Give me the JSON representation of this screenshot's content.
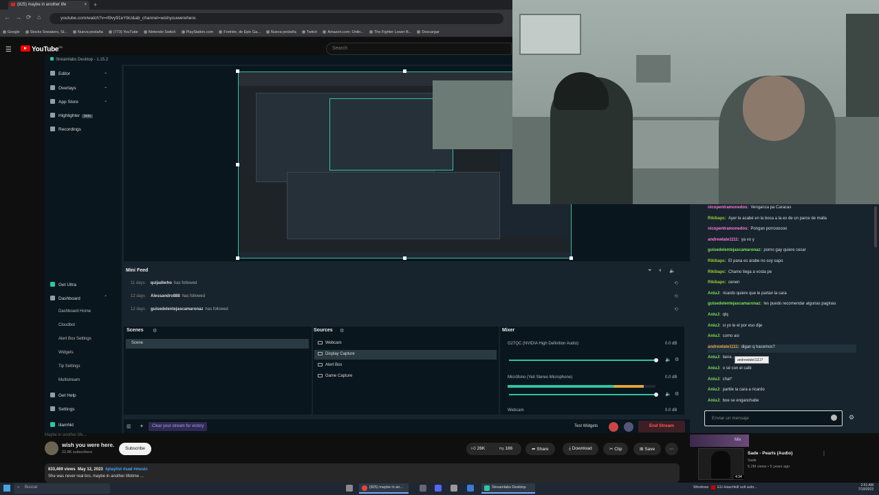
{
  "browser": {
    "tab_title": "(825) maybe in another life",
    "tab_close": "×",
    "new_tab": "+",
    "nav": [
      "←",
      "→",
      "⟳",
      "⌂"
    ],
    "url": "youtube.com/watch?v=rl9vy91eYbU&ab_channel=wishyouwerehere.",
    "bookmarks": [
      "Google",
      "Stockx Sneakers, St...",
      "Nueva pestaña",
      "(773) YouTube",
      "Nintendo Switch",
      "PlayStation.com",
      "Fortnite, de Epic Ga...",
      "Nueva pestaña",
      "Twitch",
      "Amazon.com: Onlin...",
      "The Fighter Lower B...",
      "Descargar"
    ]
  },
  "youtube": {
    "logo": "YouTube",
    "logo_sup": "CO",
    "search_placeholder": "Search",
    "menu_glyph": "☰",
    "channel": "wish you were here.",
    "subscribers": "22.8K subscribers",
    "subscribe": "Subscribe",
    "likes": "26K",
    "dislikes": "186",
    "share": "Share",
    "download": "Download",
    "clip": "Clip",
    "save": "Save",
    "more": "⋯",
    "views": "833,469 views",
    "date": "May 12, 2023",
    "hashtags": "#playlist #sad #music",
    "description": "She was never real bro, maybe in another lifetime ...",
    "cut_title": "Maybe in another life...",
    "suggested": {
      "mix": "Mix",
      "title": "Sade - Pearls (Audio)",
      "channel": "Sade",
      "meta": "5.2M views • 5 years ago",
      "duration": "4:34",
      "more": "⋮"
    }
  },
  "streamlabs": {
    "app_title": "Streamlabs Desktop - 1.15.2",
    "nav": [
      {
        "label": "Editor"
      },
      {
        "label": "Overlays"
      },
      {
        "label": "App Store"
      },
      {
        "label": "Highlighter",
        "badge": "beta"
      },
      {
        "label": "Recordings"
      }
    ],
    "nav2": [
      {
        "label": "Get Ultra"
      },
      {
        "label": "Dashboard"
      }
    ],
    "dashboard_sub": [
      "Dashboard Home",
      "Cloudbot",
      "Alert Box Settings",
      "Widgets",
      "Tip Settings",
      "Multistream"
    ],
    "nav3": [
      {
        "label": "Get Help"
      },
      {
        "label": "Settings"
      },
      {
        "label": "lilamhkt"
      }
    ],
    "mini_feed": {
      "title": "Mini Feed",
      "rows": [
        {
          "time": "11 days",
          "user": "quijadiwho",
          "action": "has followed"
        },
        {
          "time": "12 days",
          "user": "Alessandro888",
          "action": "has followed"
        },
        {
          "time": "12 days",
          "user": "guisedelentejascamaronaz",
          "action": "has followed"
        }
      ]
    },
    "scenes": {
      "title": "Scenes",
      "items": [
        "Scene"
      ]
    },
    "sources": {
      "title": "Sources",
      "items": [
        "Webcam",
        "Display Capture",
        "Alert Box",
        "Game Capture"
      ]
    },
    "mixer": {
      "title": "Mixer",
      "channels": [
        {
          "name": "G27QC (NVIDIA High Definition Audio)",
          "db": "0.0 dB",
          "level": 0.0
        },
        {
          "name": "Micrófono (Yeti Stereo Microphone)",
          "db": "0.0 dB",
          "level": 0.92
        },
        {
          "name": "Webcam",
          "db": "0.0 dB"
        }
      ]
    },
    "footer": {
      "promo": "Clear your stream for victory",
      "test_widgets": "Test Widgets",
      "end_stream": "End Stream"
    }
  },
  "chat": {
    "messages": [
      {
        "user": "nicopentramonedos:",
        "text": "Venganza pa Caracas",
        "color": "#ff7ad9"
      },
      {
        "user": "Rikibapc:",
        "text": "Ayer le acabé en la boca a la ex de un parce de malla",
        "color": "#9acd32"
      },
      {
        "user": "nicopentramonedos:",
        "text": "Pongan porroooooo",
        "color": "#ff7ad9"
      },
      {
        "user": "andrewlate1111:",
        "text": "ya vo y",
        "color": "#ff7ad9"
      },
      {
        "user": "guisedelentejascamaronaz:",
        "text": "porno gay quiere cesar",
        "color": "#7ce35a"
      },
      {
        "user": "Rikibapc:",
        "text": "El pana es árabe no soy sapo",
        "color": "#9acd32"
      },
      {
        "user": "Rikibapc:",
        "text": "Chamo llega a vosta pe",
        "color": "#9acd32"
      },
      {
        "user": "Rikibapc:",
        "text": "cenen",
        "color": "#9acd32"
      },
      {
        "user": "AniuJ:",
        "text": "ricardo quiere que le partan la cara",
        "color": "#7ce35a"
      },
      {
        "user": "guisedelentejascamaronaz:",
        "text": "les puedo recomendar algunas paginas",
        "color": "#7ce35a"
      },
      {
        "user": "AniuJ:",
        "text": "qlq",
        "color": "#7ce35a"
      },
      {
        "user": "AniuJ:",
        "text": "si yo le el por eso dije",
        "color": "#7ce35a"
      },
      {
        "user": "AniuJ:",
        "text": "como asi",
        "color": "#7ce35a"
      },
      {
        "user": "andrewlate1111:",
        "text": "digan q hacemos?",
        "color": "#e8a24a"
      },
      {
        "user": "AniuJ:",
        "text": "tiene…",
        "color": "#7ce35a"
      },
      {
        "user": "AniuJ:",
        "text": "o sé con el café",
        "color": "#7ce35a"
      },
      {
        "user": "AniuJ:",
        "text": "chat*",
        "color": "#7ce35a"
      },
      {
        "user": "AniuJ:",
        "text": "partile la cara a ricardo",
        "color": "#7ce35a"
      },
      {
        "user": "AniuJ:",
        "text": "boe se enganchabe",
        "color": "#7ce35a"
      }
    ],
    "tooltip": "andrewlate1111?",
    "input_placeholder": "Enviar un mensaje"
  },
  "taskbar": {
    "search": "Buscar",
    "apps": [
      {
        "label": "(825) maybe in an..."
      },
      {
        "label": "Streamlabs Desktop"
      }
    ],
    "tray_app": "Windows",
    "tray_news": "EU-Haschkill soll aufs...",
    "time": "2:51 AM",
    "date": "7/19/2023"
  },
  "colors": {
    "accent": "#31c3a2",
    "app_bg": "#17242d",
    "panel_bg": "#09161d",
    "end_stream": "#ff5c5c"
  }
}
